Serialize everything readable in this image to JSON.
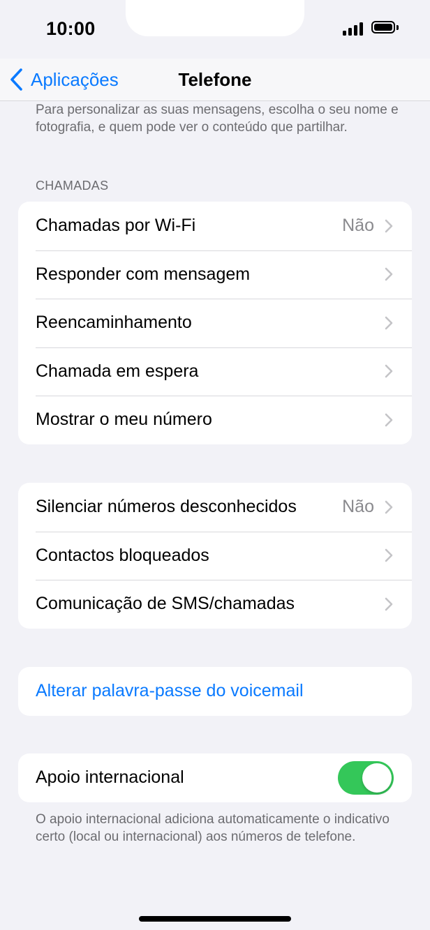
{
  "status_bar": {
    "time": "10:00"
  },
  "nav": {
    "back_label": "Aplicações",
    "title": "Telefone"
  },
  "intro_text": "Para personalizar as suas mensagens, escolha o seu nome e fotografia, e quem pode ver o conteúdo que partilhar.",
  "calls_section": {
    "header": "CHAMADAS",
    "rows": [
      {
        "label": "Chamadas por Wi-Fi",
        "value": "Não"
      },
      {
        "label": "Responder com mensagem",
        "value": ""
      },
      {
        "label": "Reencaminhamento",
        "value": ""
      },
      {
        "label": "Chamada em espera",
        "value": ""
      },
      {
        "label": "Mostrar o meu número",
        "value": ""
      }
    ]
  },
  "blocking_section": {
    "rows": [
      {
        "label": "Silenciar números desconhecidos",
        "value": "Não"
      },
      {
        "label": "Contactos bloqueados",
        "value": ""
      },
      {
        "label": "Comunicação de SMS/chamadas",
        "value": ""
      }
    ]
  },
  "voicemail": {
    "link_label": "Alterar palavra-passe do voicemail"
  },
  "international": {
    "label": "Apoio internacional",
    "enabled": true,
    "footer": "O apoio internacional adiciona automaticamente o indicativo certo (local ou internacional) aos números de telefone."
  },
  "colors": {
    "accent": "#0a7aff",
    "toggle_on": "#34c759",
    "background": "#f2f2f7"
  }
}
